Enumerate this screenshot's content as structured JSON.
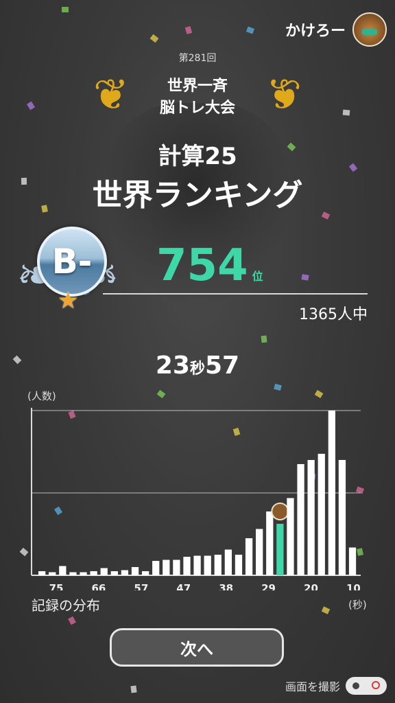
{
  "header": {
    "user_name": "かけろー"
  },
  "contest": {
    "round": "第281回",
    "title_line1": "世界一斉",
    "title_line2": "脳トレ大会"
  },
  "game": {
    "name": "計算25",
    "ranking_title": "世界ランキング"
  },
  "rank": {
    "badge": "B-",
    "number": "754",
    "unit": "位",
    "participants": "1365人中"
  },
  "time": {
    "seconds": "23",
    "sec_unit": "秒",
    "hundredths": "57"
  },
  "colors": {
    "accent": "#3ed7a8",
    "bar": "#ffffff",
    "gold": "#e0a81b"
  },
  "chart_data": {
    "type": "bar",
    "title": "",
    "ylabel": "(人数)",
    "xlabel": "記録の分布",
    "xunit": "(秒)",
    "x_tick_labels": [
      "75",
      "66",
      "57",
      "47",
      "38",
      "29",
      "20",
      "10"
    ],
    "values": [
      4,
      3,
      9,
      3,
      3,
      4,
      7,
      4,
      5,
      8,
      4,
      14,
      15,
      15,
      18,
      19,
      19,
      20,
      25,
      20,
      36,
      45,
      62,
      50,
      75,
      108,
      112,
      118,
      160,
      112,
      27
    ],
    "highlight_index": 23,
    "ylim": [
      0,
      160
    ],
    "grid": true
  },
  "buttons": {
    "next": "次へ"
  },
  "footer": {
    "capture_label": "画面を撮影"
  }
}
